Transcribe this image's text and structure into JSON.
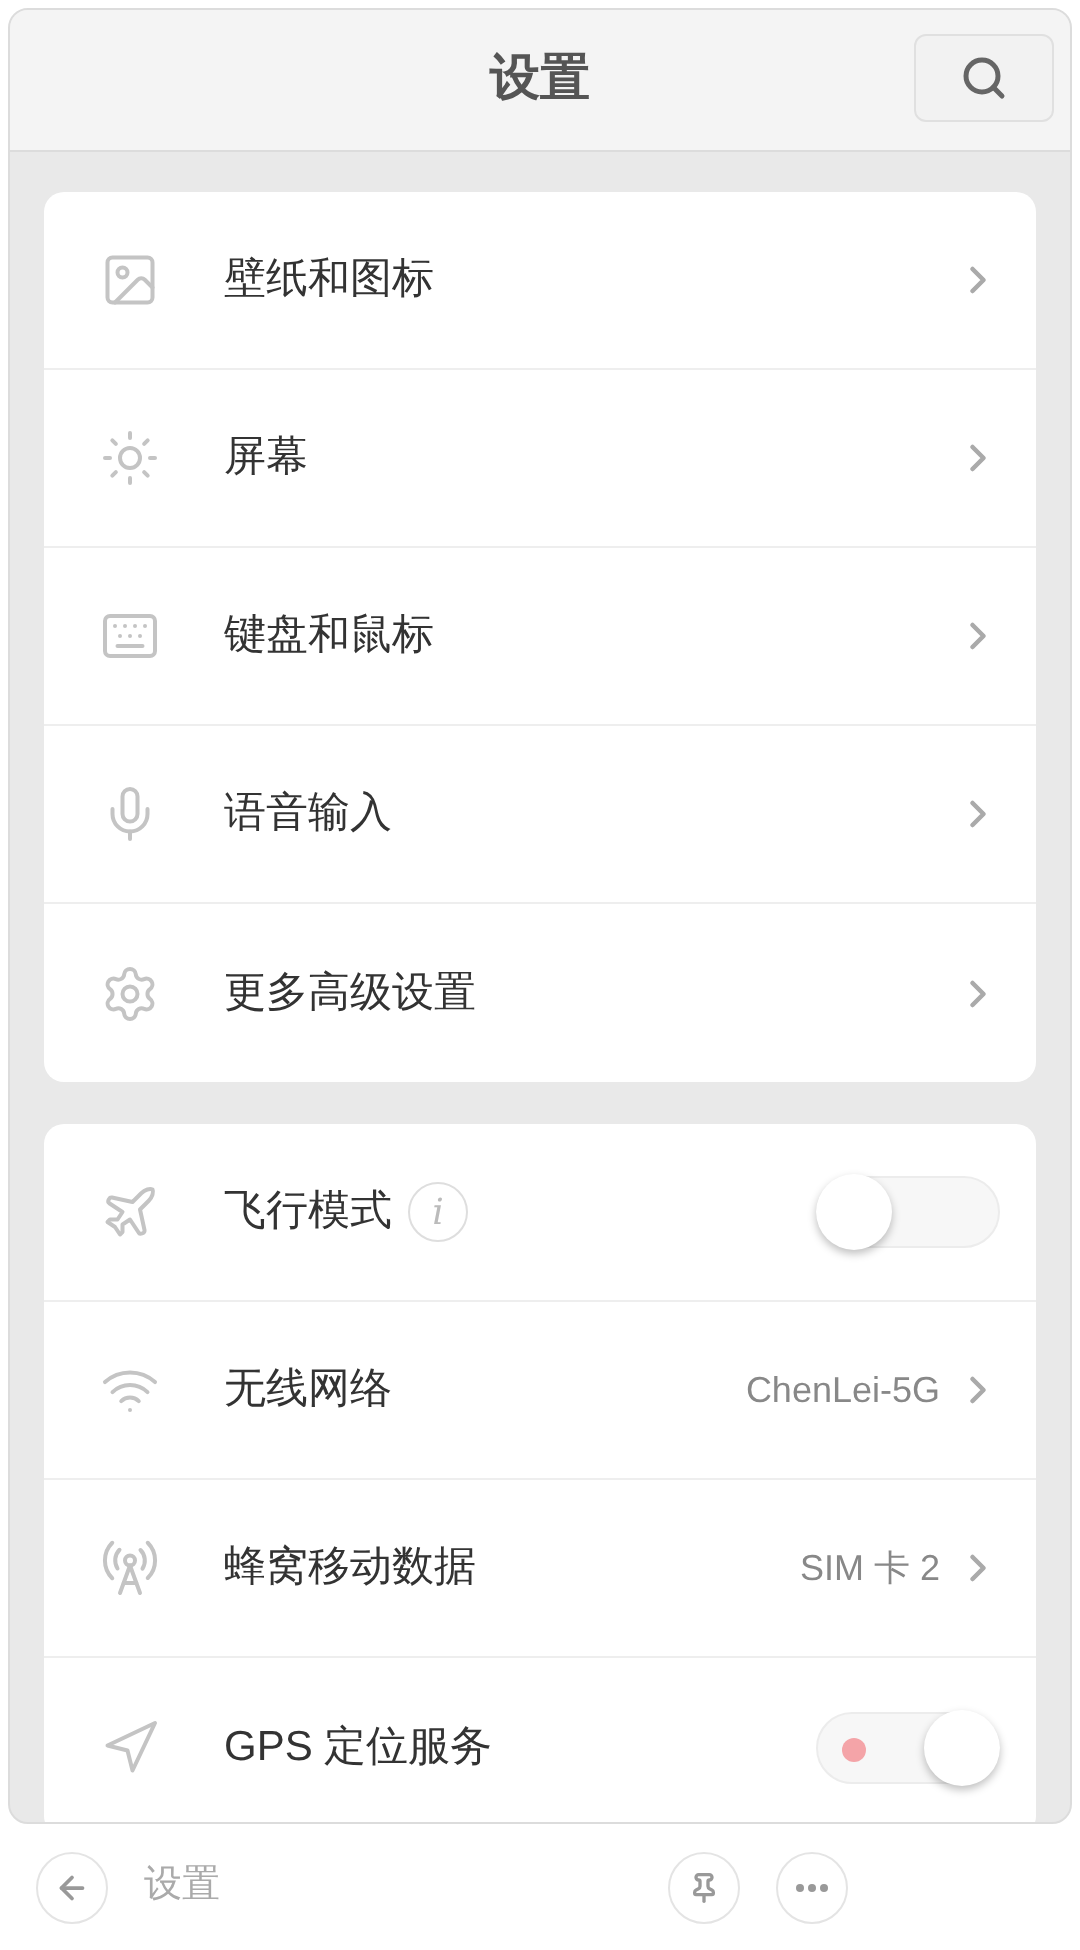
{
  "header": {
    "title": "设置"
  },
  "groups": [
    {
      "items": [
        {
          "kind": "link",
          "label": "壁纸和图标"
        },
        {
          "kind": "link",
          "label": "屏幕"
        },
        {
          "kind": "link",
          "label": "键盘和鼠标"
        },
        {
          "kind": "link",
          "label": "语音输入"
        },
        {
          "kind": "link",
          "label": "更多高级设置"
        }
      ]
    },
    {
      "items": [
        {
          "kind": "toggle",
          "label": "飞行模式",
          "info": "i",
          "on": false
        },
        {
          "kind": "link",
          "label": "无线网络",
          "value": "ChenLei-5G"
        },
        {
          "kind": "link",
          "label": "蜂窝移动数据",
          "value": "SIM 卡 2"
        },
        {
          "kind": "toggle",
          "label": "GPS 定位服务",
          "on": true
        }
      ]
    }
  ],
  "bottom_bar": {
    "title": "设置"
  }
}
